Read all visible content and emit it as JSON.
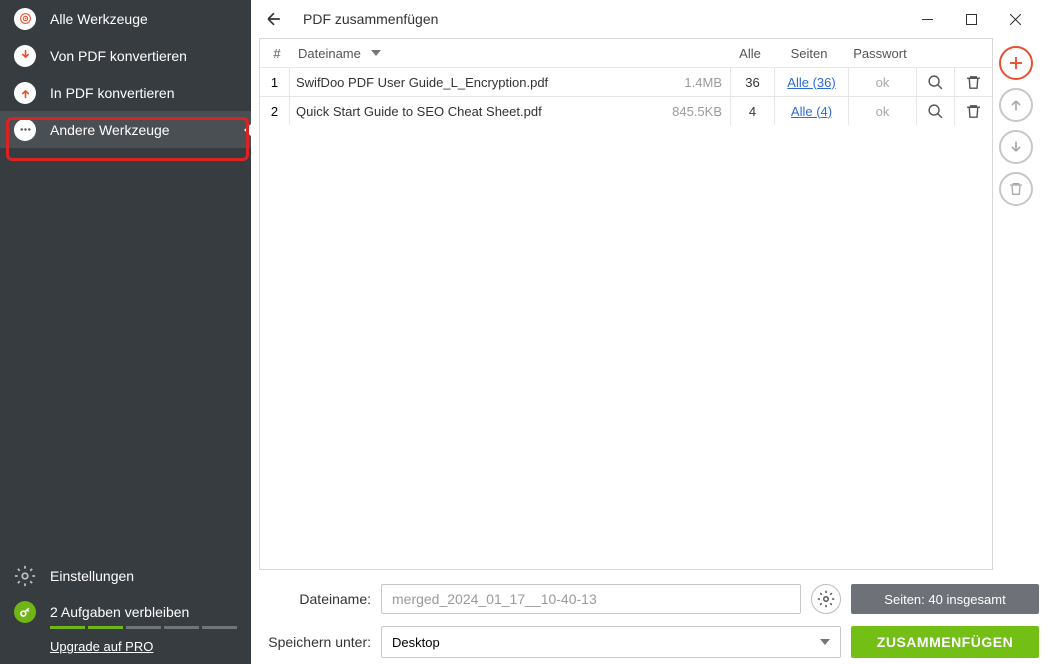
{
  "title": "PDF zusammenfügen",
  "sidebar": {
    "items": [
      {
        "label": "Alle Werkzeuge"
      },
      {
        "label": "Von PDF konvertieren"
      },
      {
        "label": "In PDF konvertieren"
      },
      {
        "label": "Andere Werkzeuge"
      }
    ],
    "settings": "Einstellungen",
    "tasks": "2 Aufgaben verbleiben",
    "upgrade": "Upgrade auf PRO"
  },
  "table": {
    "headers": {
      "idx": "#",
      "name": "Dateiname",
      "all": "Alle",
      "pages": "Seiten",
      "pw": "Passwort"
    },
    "rows": [
      {
        "idx": "1",
        "name": "SwifDoo PDF User Guide_L_Encryption.pdf",
        "size": "1.4MB",
        "all": "36",
        "pages": "Alle (36)",
        "pw": "ok"
      },
      {
        "idx": "2",
        "name": "Quick Start Guide to SEO Cheat Sheet.pdf",
        "size": "845.5KB",
        "all": "4",
        "pages": "Alle (4)",
        "pw": "ok"
      }
    ]
  },
  "bottom": {
    "filename_label": "Dateiname:",
    "filename_value": "merged_2024_01_17__10-40-13",
    "pages_total": "Seiten: 40 insgesamt",
    "save_label": "Speichern unter:",
    "save_value": "Desktop",
    "merge": "ZUSAMMENFÜGEN"
  }
}
